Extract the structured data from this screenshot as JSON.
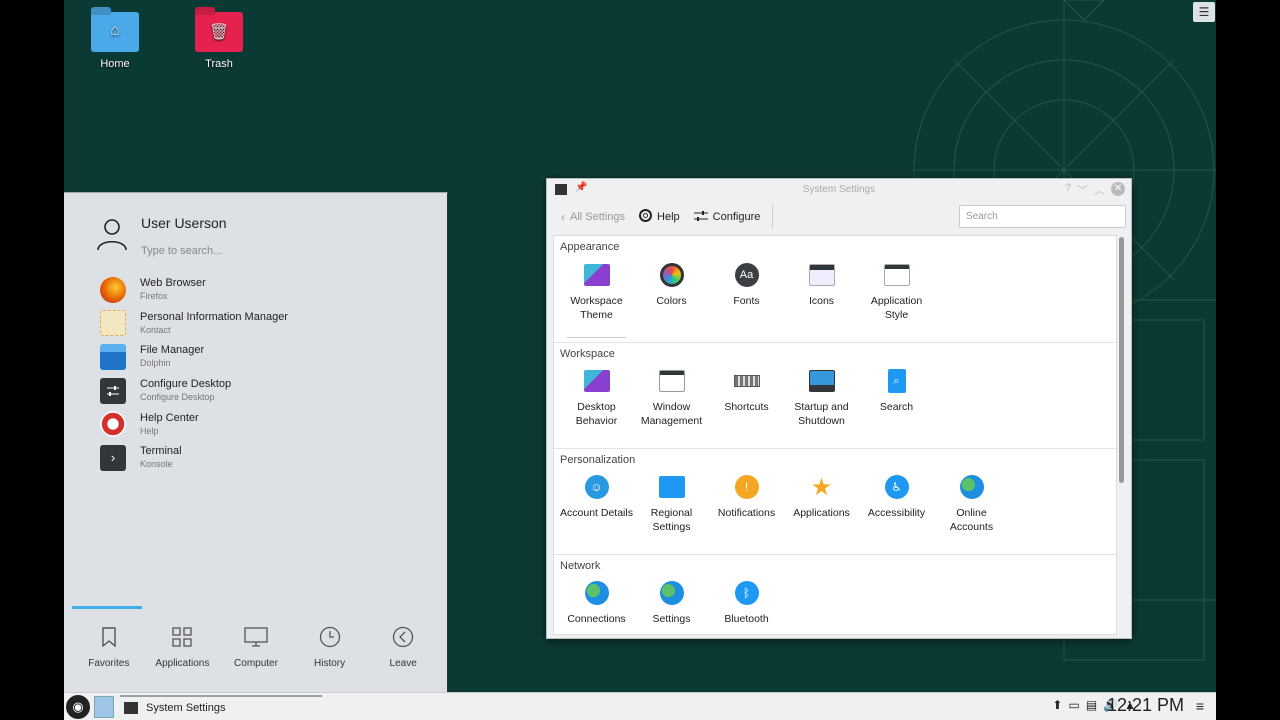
{
  "desktop": {
    "icons": [
      {
        "label": "Home",
        "glyph": "⌂"
      },
      {
        "label": "Trash",
        "glyph": "🗑"
      }
    ]
  },
  "launcher": {
    "user": "User Userson",
    "search_placeholder": "Type to search...",
    "favorites": [
      {
        "name": "Web Browser",
        "sub": "Firefox",
        "icon": "firefox-icon",
        "color": "#e66000"
      },
      {
        "name": "Personal Information Manager",
        "sub": "Kontact",
        "icon": "kontact-icon",
        "color": "#f0c040"
      },
      {
        "name": "File Manager",
        "sub": "Dolphin",
        "icon": "dolphin-icon",
        "color": "#2a80d0"
      },
      {
        "name": "Configure Desktop",
        "sub": "Configure Desktop",
        "icon": "configure-icon",
        "color": "#31363b"
      },
      {
        "name": "Help Center",
        "sub": "Help",
        "icon": "help-icon",
        "color": "#da3030"
      },
      {
        "name": "Terminal",
        "sub": "Konsole",
        "icon": "terminal-icon",
        "color": "#31363b"
      }
    ],
    "tabs": [
      {
        "label": "Favorites",
        "icon": "bookmark-icon"
      },
      {
        "label": "Applications",
        "icon": "grid-icon"
      },
      {
        "label": "Computer",
        "icon": "monitor-icon"
      },
      {
        "label": "History",
        "icon": "clock-icon"
      },
      {
        "label": "Leave",
        "icon": "back-circle-icon"
      }
    ]
  },
  "settings": {
    "title": "System Settings",
    "toolbar": {
      "back": "All Settings",
      "help": "Help",
      "configure": "Configure",
      "search_placeholder": "Search"
    },
    "categories": [
      {
        "name": "Appearance",
        "items": [
          {
            "label": "Workspace Theme",
            "icon": "workspace-theme-icon"
          },
          {
            "label": "Colors",
            "icon": "colors-icon"
          },
          {
            "label": "Fonts",
            "icon": "fonts-icon"
          },
          {
            "label": "Icons",
            "icon": "icons-icon"
          },
          {
            "label": "Application Style",
            "icon": "application-style-icon"
          }
        ]
      },
      {
        "name": "Workspace",
        "items": [
          {
            "label": "Desktop Behavior",
            "icon": "desktop-behavior-icon"
          },
          {
            "label": "Window Management",
            "icon": "window-management-icon"
          },
          {
            "label": "Shortcuts",
            "icon": "keyboard-icon"
          },
          {
            "label": "Startup and Shutdown",
            "icon": "startup-icon"
          },
          {
            "label": "Search",
            "icon": "search-icon"
          }
        ]
      },
      {
        "name": "Personalization",
        "items": [
          {
            "label": "Account Details",
            "icon": "account-icon"
          },
          {
            "label": "Regional Settings",
            "icon": "regional-icon"
          },
          {
            "label": "Notifications",
            "icon": "notifications-icon"
          },
          {
            "label": "Applications",
            "icon": "star-icon"
          },
          {
            "label": "Accessibility",
            "icon": "accessibility-icon"
          },
          {
            "label": "Online Accounts",
            "icon": "globe-icon"
          }
        ]
      },
      {
        "name": "Network",
        "items": [
          {
            "label": "Connections",
            "icon": "globe-icon"
          },
          {
            "label": "Settings",
            "icon": "globe-icon"
          },
          {
            "label": "Bluetooth",
            "icon": "bluetooth-icon"
          }
        ]
      }
    ]
  },
  "taskbar": {
    "task": "System Settings",
    "clock": "12:21 PM"
  }
}
